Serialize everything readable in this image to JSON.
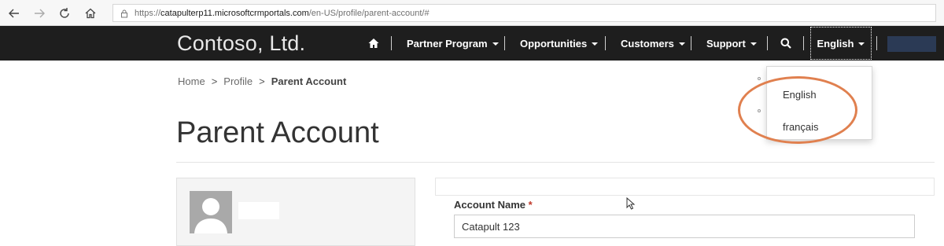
{
  "browser": {
    "url_prefix": "https://",
    "url_host": "catapulterp11.microsoftcrmportals.com",
    "url_path": "/en-US/profile/parent-account/#"
  },
  "navbar": {
    "brand": "Contoso, Ltd.",
    "items": [
      {
        "label": "Partner Program"
      },
      {
        "label": "Opportunities"
      },
      {
        "label": "Customers"
      },
      {
        "label": "Support"
      }
    ],
    "language_label": "English"
  },
  "language_menu": {
    "options": [
      "English",
      "français"
    ]
  },
  "breadcrumb": {
    "items": [
      "Home",
      "Profile"
    ],
    "active": "Parent Account",
    "separator": ">"
  },
  "page": {
    "title": "Parent Account"
  },
  "form": {
    "account_name_label": "Account Name",
    "required_marker": "*",
    "account_name_value": "Catapult 123"
  },
  "colors": {
    "navbar_bg": "#1e1e1e",
    "highlight": "#e0804f"
  }
}
